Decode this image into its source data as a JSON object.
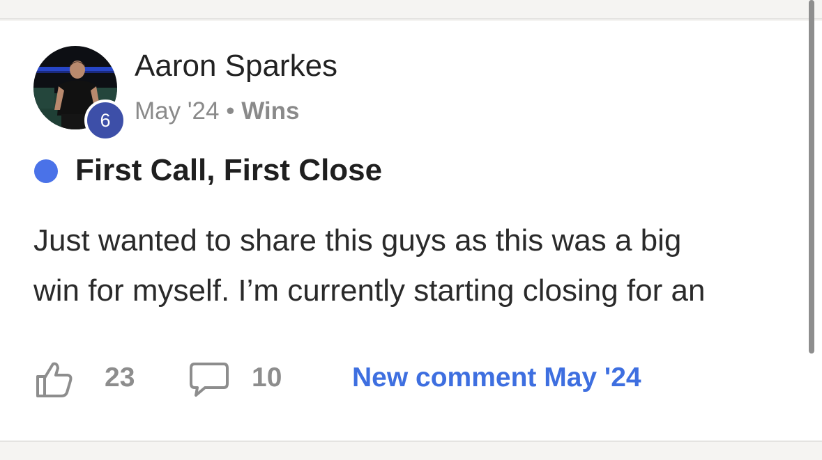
{
  "post": {
    "author": "Aaron Sparkes",
    "level": "6",
    "date": "May '24",
    "separator": "•",
    "category": "Wins",
    "title": "First Call, First Close",
    "body_lines": [
      "Just wanted to share this guys as this was a big",
      "win for myself. I’m currently starting closing for an"
    ],
    "likes": "23",
    "comments": "10",
    "last_activity": "New comment May '24"
  },
  "icons": {
    "like": "thumbs-up-icon",
    "comment": "comment-bubble-icon"
  },
  "colors": {
    "accent": "#3e6fe0",
    "title_dot": "#4a72e8",
    "level_badge": "#3d4fa8",
    "muted_text": "#8a8a8a"
  }
}
